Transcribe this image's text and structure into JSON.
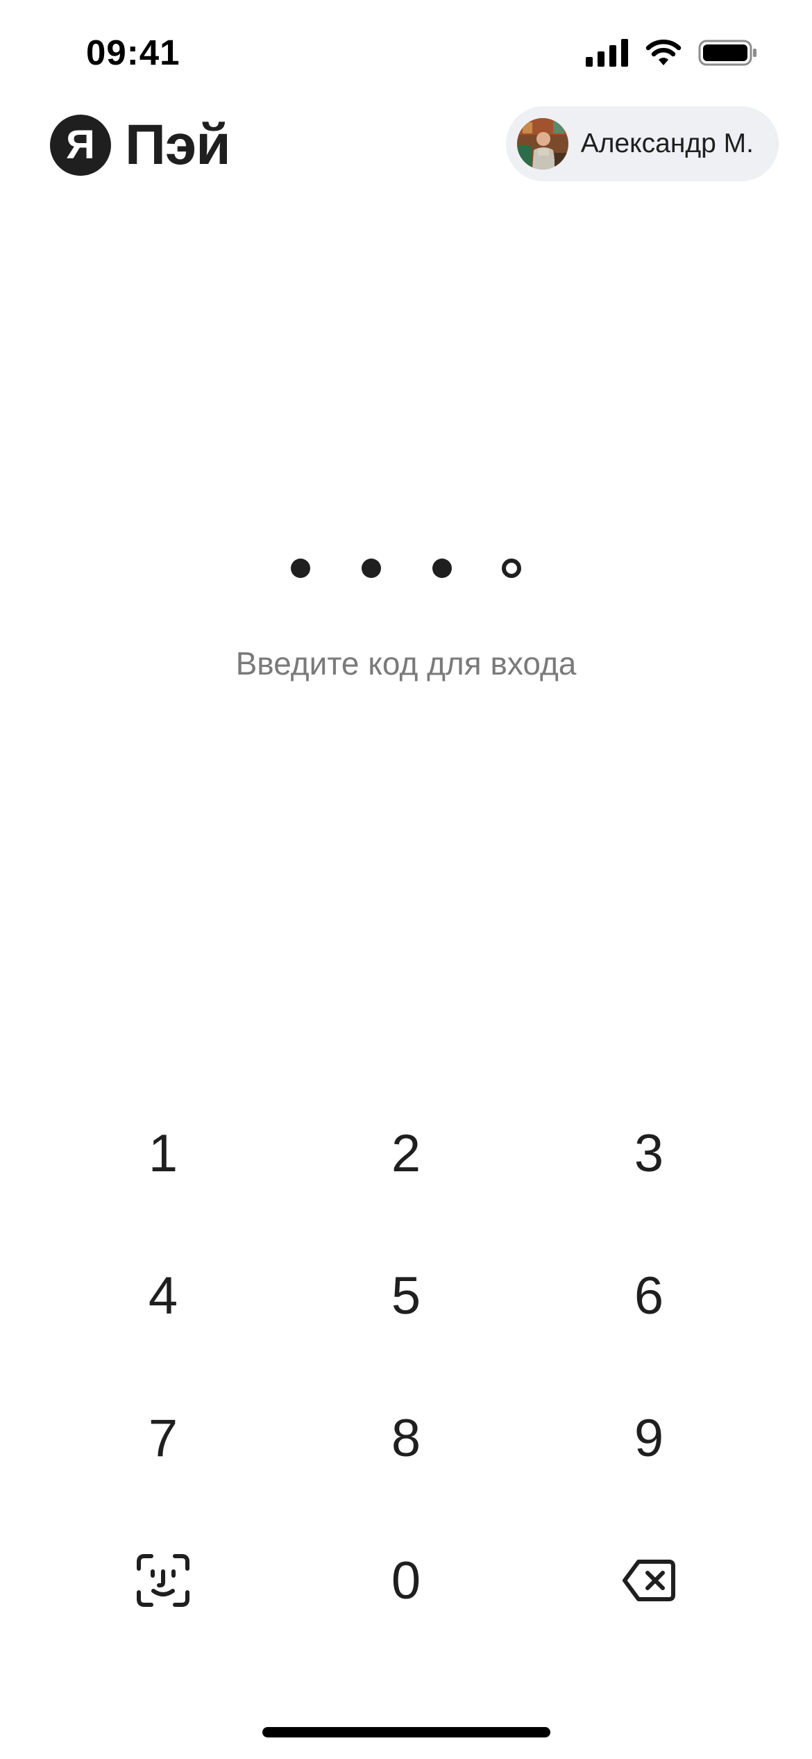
{
  "status_bar": {
    "time": "09:41"
  },
  "header": {
    "logo_letter": "Я",
    "logo_text": "Пэй",
    "profile_name": "Александр М."
  },
  "pin": {
    "length": 4,
    "entered": 3,
    "prompt": "Введите код для входа"
  },
  "keypad": {
    "k1": "1",
    "k2": "2",
    "k3": "3",
    "k4": "4",
    "k5": "5",
    "k6": "6",
    "k7": "7",
    "k8": "8",
    "k9": "9",
    "k0": "0",
    "left_icon": "face-id-icon",
    "right_icon": "backspace-icon"
  },
  "colors": {
    "text": "#1f1f1f",
    "muted": "#7a7a7a",
    "chip_bg": "#eef0f3",
    "background": "#ffffff"
  }
}
